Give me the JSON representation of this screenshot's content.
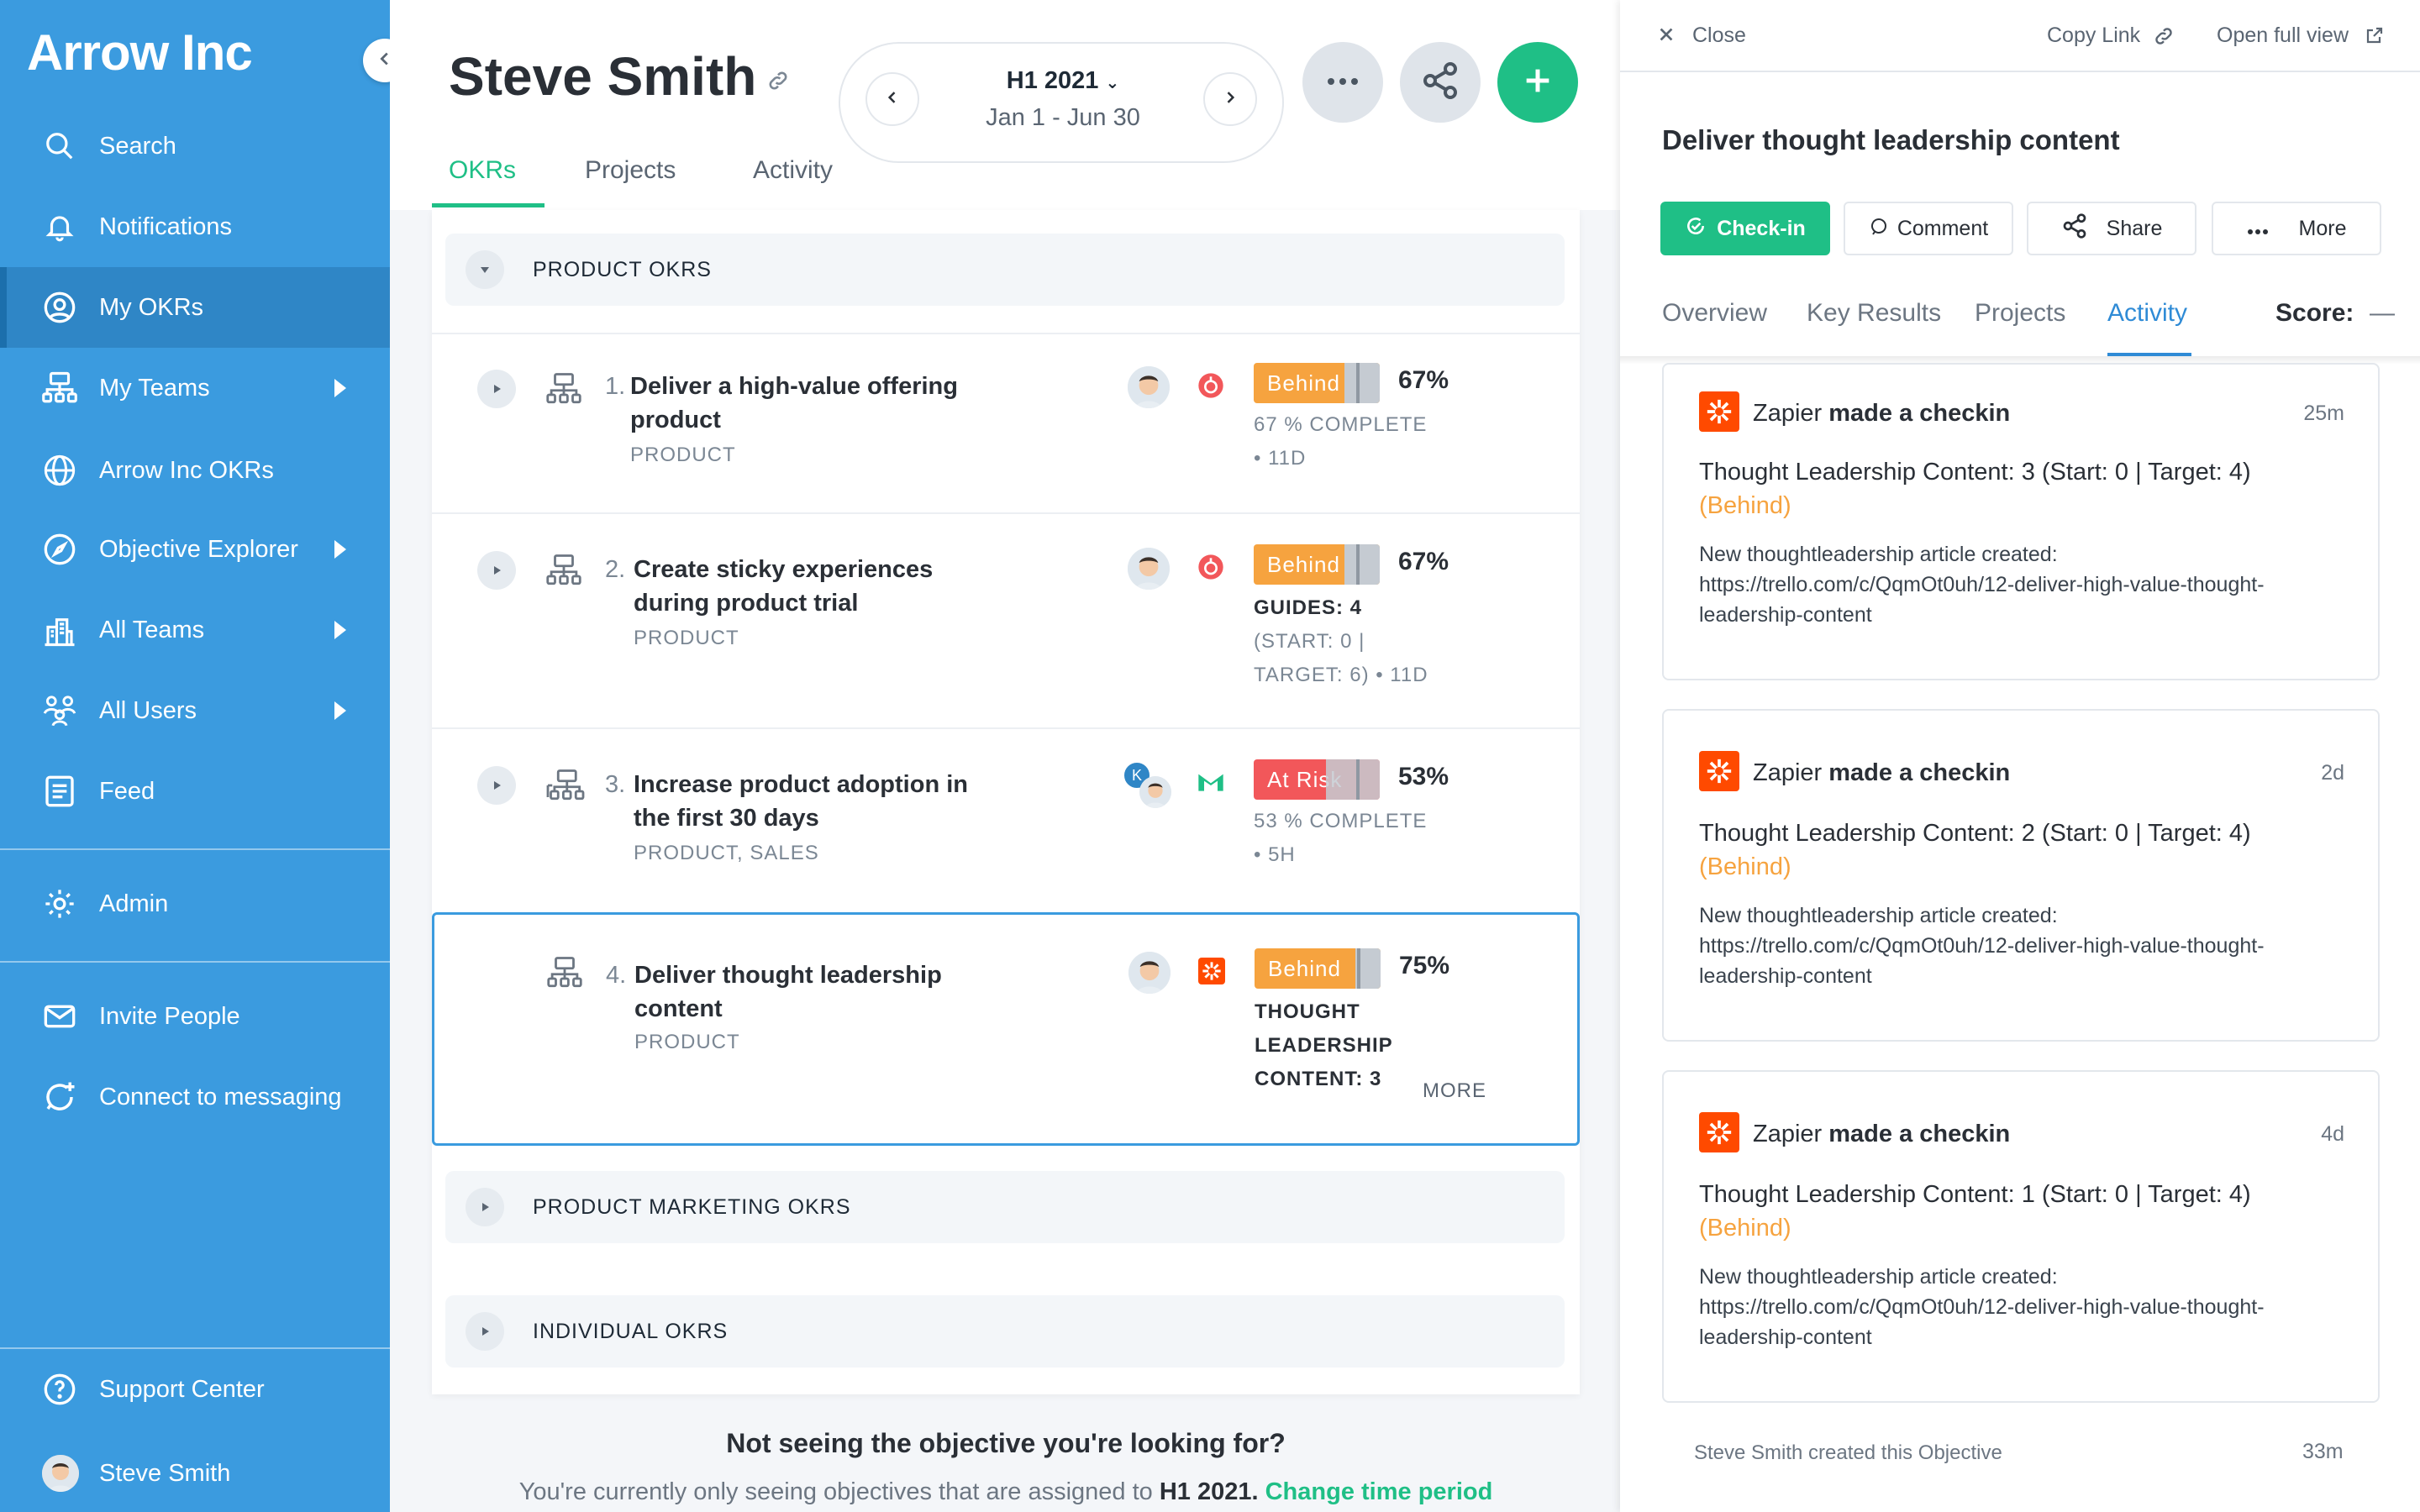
{
  "sidebar": {
    "brand": "Arrow Inc",
    "items": [
      {
        "label": "Search",
        "icon": "search-icon"
      },
      {
        "label": "Notifications",
        "icon": "bell-icon"
      },
      {
        "label": "My OKRs",
        "icon": "user-circle-icon"
      },
      {
        "label": "My Teams",
        "icon": "org-chart-icon"
      },
      {
        "label": "Arrow Inc OKRs",
        "icon": "globe-icon"
      },
      {
        "label": "Objective Explorer",
        "icon": "compass-icon"
      },
      {
        "label": "All Teams",
        "icon": "buildings-icon"
      },
      {
        "label": "All Users",
        "icon": "users-icon"
      },
      {
        "label": "Feed",
        "icon": "feed-icon"
      },
      {
        "label": "Admin",
        "icon": "gear-icon"
      },
      {
        "label": "Invite People",
        "icon": "envelope-icon"
      },
      {
        "label": "Connect to messaging",
        "icon": "chat-plus-icon"
      },
      {
        "label": "Support Center",
        "icon": "help-icon"
      },
      {
        "label": "Steve Smith",
        "icon": "avatar"
      }
    ]
  },
  "header": {
    "title": "Steve Smith",
    "period": {
      "title": "H1 2021",
      "dates": "Jan 1 - Jun 30"
    },
    "tabs": [
      "OKRs",
      "Projects",
      "Activity"
    ]
  },
  "okrs": {
    "sections": [
      "PRODUCT OKRS",
      "PRODUCT MARKETING OKRS",
      "INDIVIDUAL OKRS"
    ],
    "rows": [
      {
        "num": "1.",
        "title": "Deliver a high-value offering product",
        "tags": "PRODUCT",
        "status": "Behind",
        "pct": "67%",
        "detail1": "67 % COMPLETE",
        "detail2": "• 11D"
      },
      {
        "num": "2.",
        "title": "Create sticky experiences during product trial",
        "tags": "PRODUCT",
        "status": "Behind",
        "pct": "67%",
        "detail1": "GUIDES: 4",
        "detail2": "(START: 0 |",
        "detail3": "TARGET: 6) • 11D"
      },
      {
        "num": "3.",
        "title": "Increase product adoption in the first 30 days",
        "tags": "PRODUCT, SALES",
        "status": "At Risk",
        "pct": "53%",
        "detail1": "53 % COMPLETE",
        "detail2": "• 5H"
      },
      {
        "num": "4.",
        "title": "Deliver thought leadership content",
        "tags": "PRODUCT",
        "status": "Behind",
        "pct": "75%",
        "detail1": "THOUGHT",
        "detail2": "LEADERSHIP",
        "detail3": "CONTENT: 3",
        "more": "MORE"
      }
    ],
    "footer_question": "Not seeing the objective you're looking for?",
    "footer_note_prefix": "You're currently only seeing objectives that are assigned to",
    "footer_note_period": "H1 2021.",
    "footer_note_link": "Change time period"
  },
  "panel": {
    "close": "Close",
    "copy_link": "Copy Link",
    "open_full": "Open full view",
    "title": "Deliver thought leadership content",
    "buttons": {
      "checkin": "Check-in",
      "comment": "Comment",
      "share": "Share",
      "more": "More"
    },
    "tabs": [
      "Overview",
      "Key Results",
      "Projects",
      "Activity"
    ],
    "score_label": "Score:",
    "score_value": "—",
    "activities": [
      {
        "actor": "Zapier",
        "action": "made a checkin",
        "time": "25m",
        "kr": "Thought Leadership Content: 3 (Start: 0 | Target: 4)",
        "status": "(Behind)",
        "note": "New thoughtleadership article created: https://trello.com/c/QqmOt0uh/12-deliver-high-value-thought-leadership-content"
      },
      {
        "actor": "Zapier",
        "action": "made a checkin",
        "time": "2d",
        "kr": "Thought Leadership Content: 2 (Start: 0 | Target: 4)",
        "status": "(Behind)",
        "note": "New thoughtleadership article created: https://trello.com/c/QqmOt0uh/12-deliver-high-value-thought-leadership-content"
      },
      {
        "actor": "Zapier",
        "action": "made a checkin",
        "time": "4d",
        "kr": "Thought Leadership Content: 1 (Start: 0 | Target: 4)",
        "status": "(Behind)",
        "note": "New thoughtleadership article created: https://trello.com/c/QqmOt0uh/12-deliver-high-value-thought-leadership-content"
      }
    ],
    "created_text": "Steve Smith created this Objective",
    "created_time": "33m"
  },
  "colors": {
    "sidebar": "#3b9bdf",
    "accent_green": "#1fbf86",
    "behind": "#f6a33f",
    "at_risk": "#f2575a",
    "zapier": "#ff4a00",
    "link_blue": "#2f8bd6"
  }
}
